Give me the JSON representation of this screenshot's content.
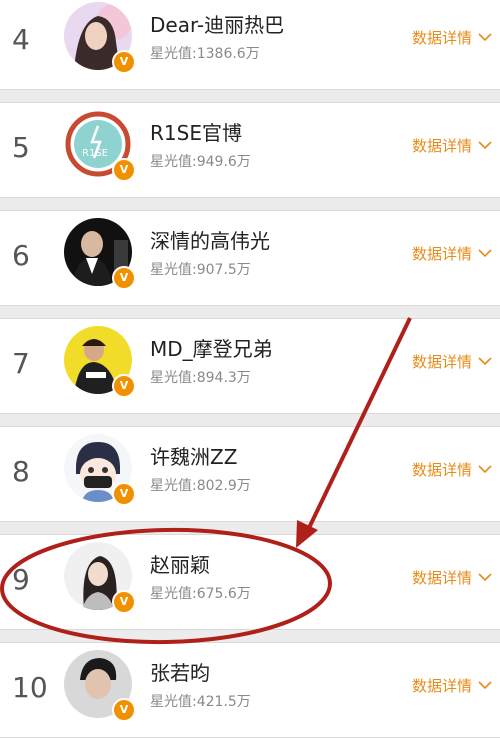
{
  "colors": {
    "accent": "#e58c1a",
    "badge": "#f29100",
    "annotation": "#b0201a",
    "name_text": "#222222",
    "stat_text": "#8a8a8a"
  },
  "rows": [
    {
      "rank": "4",
      "name": "Dear-迪丽热巴",
      "stat": "星光值:1386.6万",
      "detail": "数据详情"
    },
    {
      "rank": "5",
      "name": "R1SE官博",
      "stat": "星光值:949.6万",
      "detail": "数据详情",
      "avatar_text": "R1SE"
    },
    {
      "rank": "6",
      "name": "深情的高伟光",
      "stat": "星光值:907.5万",
      "detail": "数据详情"
    },
    {
      "rank": "7",
      "name": "MD_摩登兄弟",
      "stat": "星光值:894.3万",
      "detail": "数据详情"
    },
    {
      "rank": "8",
      "name": "许魏洲ZZ",
      "stat": "星光值:802.9万",
      "detail": "数据详情"
    },
    {
      "rank": "9",
      "name": "赵丽颖",
      "stat": "星光值:675.6万",
      "detail": "数据详情"
    },
    {
      "rank": "10",
      "name": "张若昀",
      "stat": "星光值:421.5万",
      "detail": "数据详情"
    }
  ],
  "badge_icon": "verified-v-icon",
  "badge_letter": "V",
  "chevron_icon": "chevron-down-icon"
}
